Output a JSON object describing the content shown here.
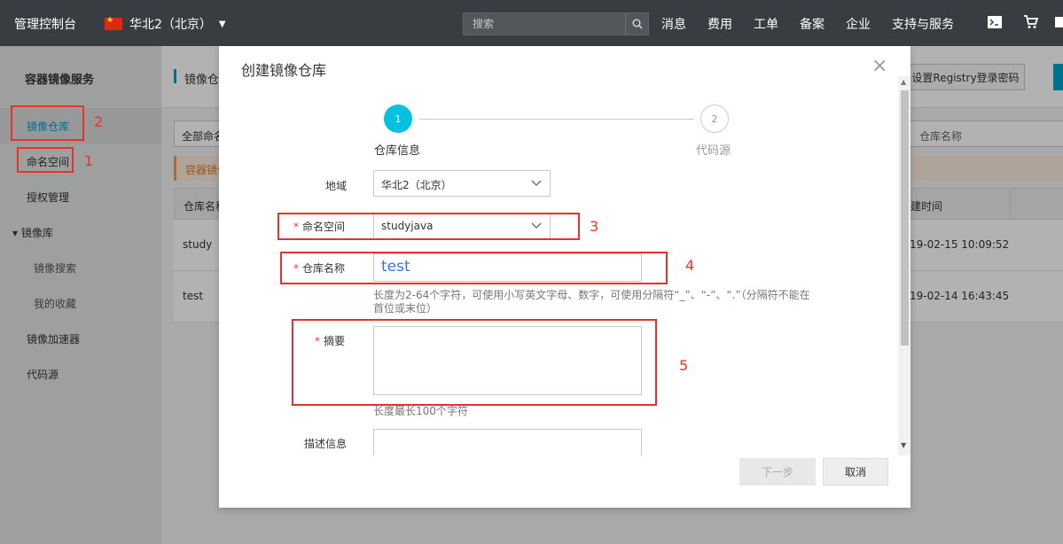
{
  "topbar": {
    "brand": "管理控制台",
    "region": "华北2（北京）",
    "search_placeholder": "搜索",
    "menu": [
      "消息",
      "费用",
      "工单",
      "备案",
      "企业",
      "支持与服务"
    ]
  },
  "sidebar": {
    "title": "容器镜像服务",
    "items": [
      "镜像仓库",
      "命名空间",
      "授权管理",
      "▾ 镜像库",
      "镜像搜索",
      "我的收藏",
      "镜像加速器",
      "代码源"
    ]
  },
  "main": {
    "title": "镜像仓",
    "registry_button": "设置Registry登录密码",
    "filter_all": "全部命名",
    "filter_name": "仓库名称",
    "notice": "容器镜像",
    "col_name": "仓库名称",
    "col_time": "建时间",
    "rows": [
      {
        "name": "study",
        "time": "19-02-15 10:09:52"
      },
      {
        "name": "test",
        "time": "19-02-14 16:43:45"
      }
    ]
  },
  "modal": {
    "title": "创建镜像仓库",
    "close": "×",
    "steps": [
      {
        "num": "1",
        "label": "仓库信息"
      },
      {
        "num": "2",
        "label": "代码源"
      }
    ],
    "region_label": "地域",
    "region_value": "华北2（北京）",
    "namespace_label": "命名空间",
    "namespace_value": "studyjava",
    "repo_name_label": "仓库名称",
    "repo_name_value": "test",
    "repo_name_hint": "长度为2-64个字符，可使用小写英文字母、数字，可使用分隔符“_”、“-”、“.”（分隔符不能在首位或末位）",
    "summary_label": "摘要",
    "summary_hint": "长度最长100个字符",
    "desc_label": "描述信息",
    "next_button": "下一步",
    "cancel_button": "取消"
  },
  "annotations": [
    "1",
    "2",
    "3",
    "4",
    "5"
  ],
  "colors": {
    "topbar": "#373d41",
    "accent": "#00c1de",
    "annotation": "#e8302f"
  }
}
